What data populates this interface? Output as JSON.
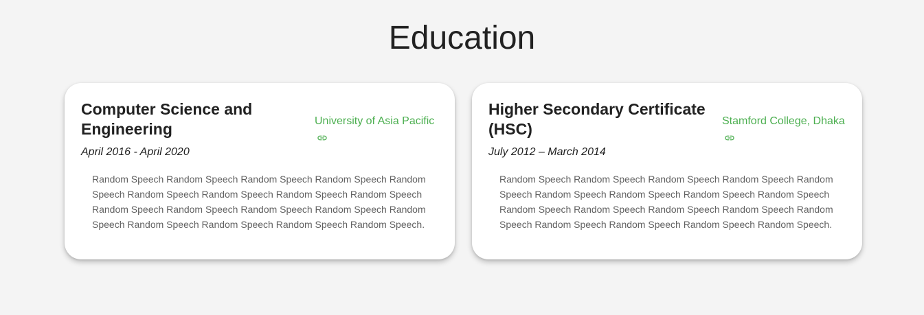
{
  "section": {
    "title": "Education"
  },
  "cards": [
    {
      "degree": "Computer Science and Engineering",
      "dates": "April 2016 - April 2020",
      "school": "University of Asia Pacific",
      "link_icon": "link-icon",
      "description": "Random Speech Random Speech Random Speech Random Speech Random Speech Random Speech Random Speech Random Speech Random Speech Random Speech Random Speech Random Speech Random Speech Random Speech Random Speech Random Speech Random Speech Random Speech."
    },
    {
      "degree": "Higher Secondary Certificate (HSC)",
      "dates": "July 2012 – March 2014",
      "school": "Stamford College, Dhaka",
      "link_icon": "link-icon",
      "description": "Random Speech Random Speech Random Speech Random Speech Random Speech Random Speech Random Speech Random Speech Random Speech Random Speech Random Speech Random Speech Random Speech Random Speech Random Speech Random Speech Random Speech Random Speech."
    }
  ],
  "colors": {
    "background": "#f4f4f4",
    "card": "#ffffff",
    "accent": "#4caf50",
    "text": "#212121",
    "muted": "#616161"
  }
}
